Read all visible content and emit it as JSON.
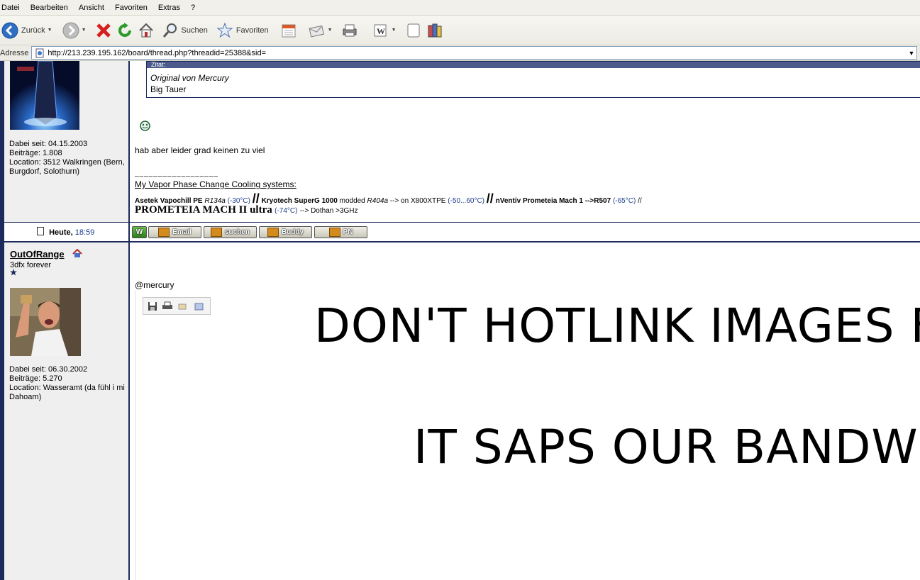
{
  "menu": [
    "Datei",
    "Bearbeiten",
    "Ansicht",
    "Favoriten",
    "Extras",
    "?"
  ],
  "toolbar": {
    "back_label": "Zurück",
    "search_label": "Suchen",
    "favorites_label": "Favoriten"
  },
  "address": {
    "label": "Adresse",
    "url": "http://213.239.195.162/board/thread.php?threadid=25388&sid="
  },
  "post1": {
    "quote_header": "Zitat:",
    "quote_author": "Original von Mercury",
    "quote_text": "Big Tauer",
    "member_since": "Dabei seit: 04.15.2003",
    "posts": "Beiträge: 1.808",
    "location": "Location: 3512 Walkringen (Bern, Burgdorf, Solothurn)",
    "message": "hab aber leider grad keinen zu viel",
    "sig_separator": "__________________",
    "sig_link": "My Vapor Phase Change Cooling systems:",
    "sig": {
      "s1_bold": "Asetek Vapochill PE",
      "s1_gas": "R134a",
      "s1_temp": "(-30°C)",
      "slashes": "//",
      "s2_bold": "Kryotech SuperG 1000",
      "s2_mid": "modded",
      "s2_gas": "R404a",
      "s2_arrow": "--> on X800XTPE",
      "s2_temp": "(-50...60°C)",
      "s3_bold": "nVentiv Prometeia Mach 1",
      "s3_arrow": "-->R507",
      "s3_temp": "(-65°C)",
      "s3_end": "//",
      "big": "PROMETEIA MACH II ultra",
      "big_temp": "(-74°C)",
      "big_end": "--> Dothan >3GHz"
    },
    "date_bold": "Heute,",
    "date_time": "18:59",
    "buttons": [
      "Email",
      "suchen",
      "Buddy",
      "PN"
    ]
  },
  "post2": {
    "username": "OutOfRange",
    "title": "3dfx forever",
    "member_since": "Dabei seit: 06.30.2002",
    "posts": "Beiträge: 5.270",
    "location": "Location: Wasseramt (da fühl i mi Dahoam)",
    "message": "@mercury",
    "hotlink_line1": "DON'T HOTLINK IMAGES FR",
    "hotlink_line2": "IT SAPS OUR BANDWID"
  },
  "colors": {
    "accent": "#1c2a5c",
    "author_bg": "#efefef",
    "link_blue": "#1c3c8c"
  },
  "icons": {
    "back": "back-arrow-icon",
    "forward": "forward-arrow-icon",
    "stop": "stop-x-icon",
    "refresh": "refresh-icon",
    "home": "home-icon",
    "search": "magnifier-icon",
    "favorites": "star-icon"
  }
}
